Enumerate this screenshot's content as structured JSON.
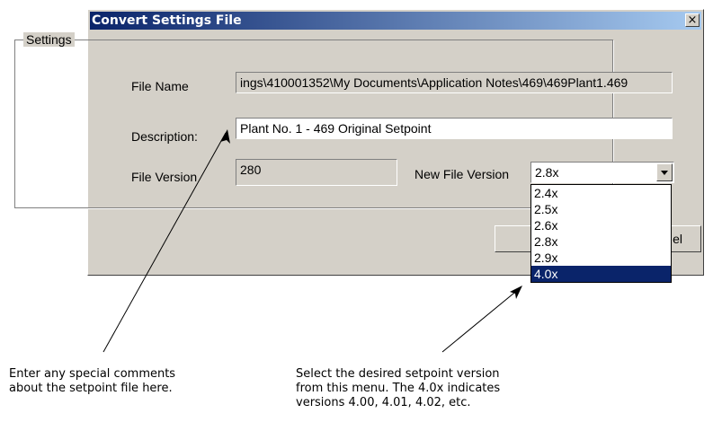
{
  "dialog": {
    "title": "Convert Settings File",
    "close_glyph": "×",
    "group_label": "Settings",
    "file_name_label": "File Name",
    "file_name_value": "ings\\410001352\\My Documents\\Application Notes\\469\\469Plant1.469",
    "description_label": "Description:",
    "description_value": "Plant No. 1 - 469 Original Setpoint",
    "file_version_label": "File Version",
    "file_version_value": "280",
    "new_file_version_label": "New File Version",
    "new_file_version_value": "2.8x",
    "cancel_partial": "el"
  },
  "dropdown": {
    "options": [
      "2.4x",
      "2.5x",
      "2.6x",
      "2.8x",
      "2.9x",
      "4.0x"
    ],
    "selected": "4.0x"
  },
  "callouts": {
    "left_line1": "Enter any special comments",
    "left_line2": "about the setpoint file here.",
    "right_line1": "Select the desired setpoint version",
    "right_line2": "from this menu. The 4.0x indicates",
    "right_line3": "versions 4.00, 4.01, 4.02, etc."
  },
  "colors": {
    "titlebar_start": "#0a246a",
    "titlebar_end": "#a6caf0",
    "dialog_face": "#d4d0c8",
    "selection": "#0a246a"
  },
  "icons": [
    "close-icon",
    "dropdown-arrow-icon",
    "callout-arrow-icon"
  ]
}
